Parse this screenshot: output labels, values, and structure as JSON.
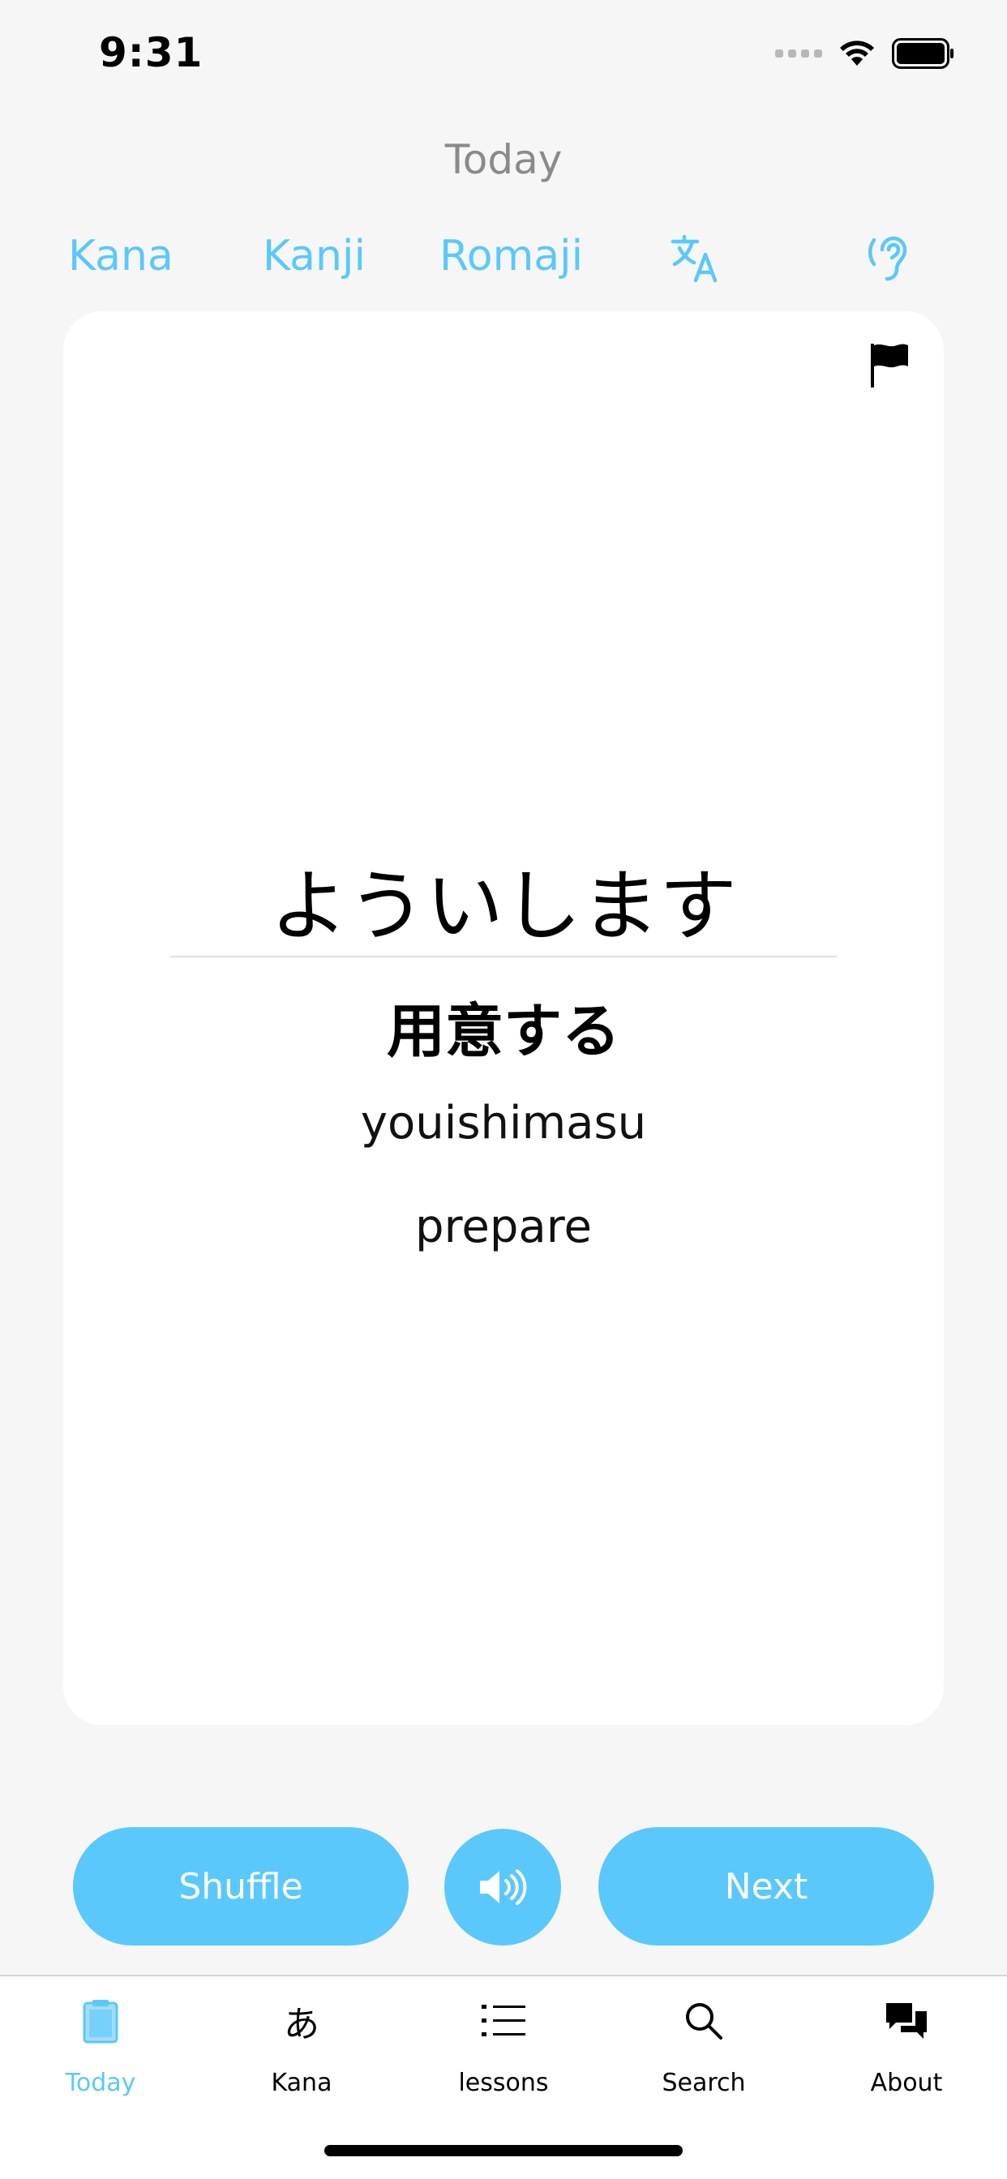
{
  "status_bar": {
    "time": "9:31"
  },
  "nav": {
    "title": "Today"
  },
  "modes": {
    "kana_label": "Kana",
    "kanji_label": "Kanji",
    "romaji_label": "Romaji",
    "translate_icon": "translate-icon",
    "listen_icon": "ear-icon"
  },
  "card": {
    "kana": "ようい​します",
    "kanji": "用意する",
    "romaji": "youishimasu",
    "meaning": "prepare",
    "flag_icon": "flag-icon"
  },
  "actions": {
    "shuffle_label": "Shuffle",
    "next_label": "Next",
    "sound_icon": "speaker-icon"
  },
  "tabbar": {
    "items": [
      {
        "label": "Today",
        "icon": "clipboard-icon",
        "active": true
      },
      {
        "label": "Kana",
        "icon": "hiragana-a-icon",
        "glyph": "あ",
        "active": false
      },
      {
        "label": "lessons",
        "icon": "list-icon",
        "active": false
      },
      {
        "label": "Search",
        "icon": "search-icon",
        "active": false
      },
      {
        "label": "About",
        "icon": "chat-bubbles-icon",
        "active": false
      }
    ]
  },
  "colors": {
    "accent": "#5ac8fa",
    "background": "#f6f6f6",
    "card": "#ffffff",
    "title_gray": "#8a8a8a"
  }
}
